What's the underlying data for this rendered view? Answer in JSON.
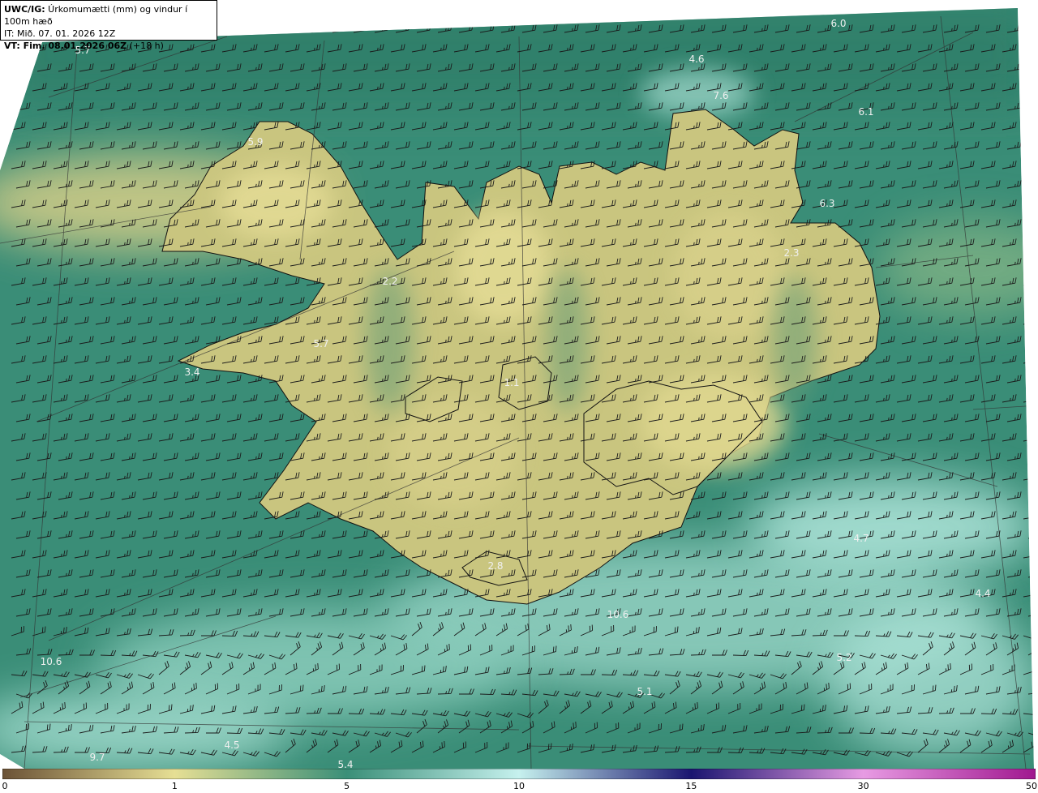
{
  "header": {
    "line1_bold": "UWC/IG:",
    "line1_text": " Úrkomumætti (mm) og vindur í 100m hæð",
    "line2": "IT: Mið. 07. 01. 2026 12Z",
    "line3_bold": "VT: Fim. 08.01.2026 06Z",
    "line3_text": " (+18 h)"
  },
  "colorbar": {
    "ticks": [
      "0",
      "1",
      "5",
      "10",
      "15",
      "30",
      "50"
    ],
    "stops": [
      {
        "value": 0,
        "color": "#6b5236"
      },
      {
        "value": 1,
        "color": "#e6df94"
      },
      {
        "value": 5,
        "color": "#3a8f78"
      },
      {
        "value": 10,
        "color": "#c6f1ee"
      },
      {
        "value": 15,
        "color": "#1a1570"
      },
      {
        "value": 30,
        "color": "#e79be3"
      },
      {
        "value": 50,
        "color": "#a0178f"
      }
    ]
  },
  "map_labels": [
    {
      "id": "label-6-0",
      "text": "6.0"
    },
    {
      "id": "label-5-7-nw",
      "text": "5.7"
    },
    {
      "id": "label-4-6",
      "text": "4.6"
    },
    {
      "id": "label-7-6",
      "text": "7.6"
    },
    {
      "id": "label-6-1",
      "text": "6.1"
    },
    {
      "id": "label-5-9",
      "text": "5.9"
    },
    {
      "id": "label-6-3",
      "text": "6.3"
    },
    {
      "id": "label-2-3",
      "text": "2.3"
    },
    {
      "id": "label-2-2",
      "text": "2.2"
    },
    {
      "id": "label-5-7-w",
      "text": "5.7"
    },
    {
      "id": "label-3-4",
      "text": "3.4"
    },
    {
      "id": "label-1-1",
      "text": "1.1"
    },
    {
      "id": "label-2-8",
      "text": "2.8"
    },
    {
      "id": "label-4-7",
      "text": "4.7"
    },
    {
      "id": "label-4-4",
      "text": "4.4"
    },
    {
      "id": "label-10-6-s",
      "text": "10.6"
    },
    {
      "id": "label-10-6-sw",
      "text": "10.6"
    },
    {
      "id": "label-5-2",
      "text": "5.2"
    },
    {
      "id": "label-5-1",
      "text": "5.1"
    },
    {
      "id": "label-4-5",
      "text": "4.5"
    },
    {
      "id": "label-9-7",
      "text": "9.7"
    },
    {
      "id": "label-5-4",
      "text": "5.4"
    }
  ]
}
